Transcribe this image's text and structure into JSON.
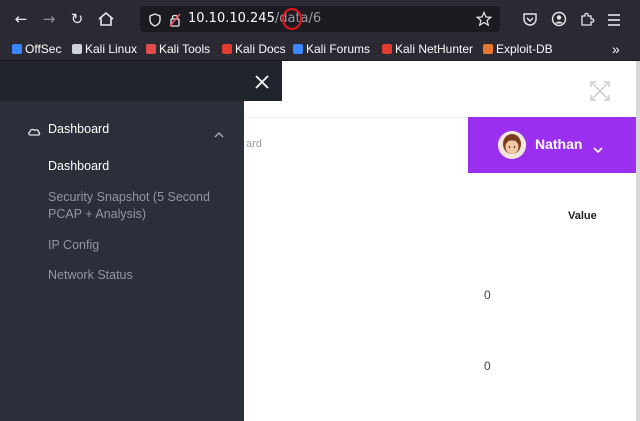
{
  "browser": {
    "url_host": "10.10.10.245",
    "url_path": "/data/6",
    "bookmarks": [
      {
        "label": "OffSec",
        "color": "#3a86ff"
      },
      {
        "label": "Kali Linux",
        "color": "#cfd2d6"
      },
      {
        "label": "Kali Tools",
        "color": "#e34a4a"
      },
      {
        "label": "Kali Docs",
        "color": "#e03c31"
      },
      {
        "label": "Kali Forums",
        "color": "#3a86ff"
      },
      {
        "label": "Kali NetHunter",
        "color": "#e03c31"
      },
      {
        "label": "Exploit-DB",
        "color": "#e6772e"
      }
    ]
  },
  "sidebar": {
    "section_label": "Dashboard",
    "items": [
      {
        "label": "Dashboard"
      },
      {
        "label": "Security Snapshot (5 Second"
      },
      {
        "label": "PCAP + Analysis)"
      },
      {
        "label": "IP Config"
      },
      {
        "label": "Network Status"
      }
    ]
  },
  "header": {
    "search_placeholder_fragment": "ard",
    "user_name": "Nathan"
  },
  "table": {
    "value_header": "Value",
    "rows": [
      {
        "value": "0"
      },
      {
        "value": "0"
      }
    ]
  },
  "colors": {
    "accent": "#9b2ff0",
    "sidebar_bg": "#2a2f3a",
    "annotation": "#e0141e"
  }
}
